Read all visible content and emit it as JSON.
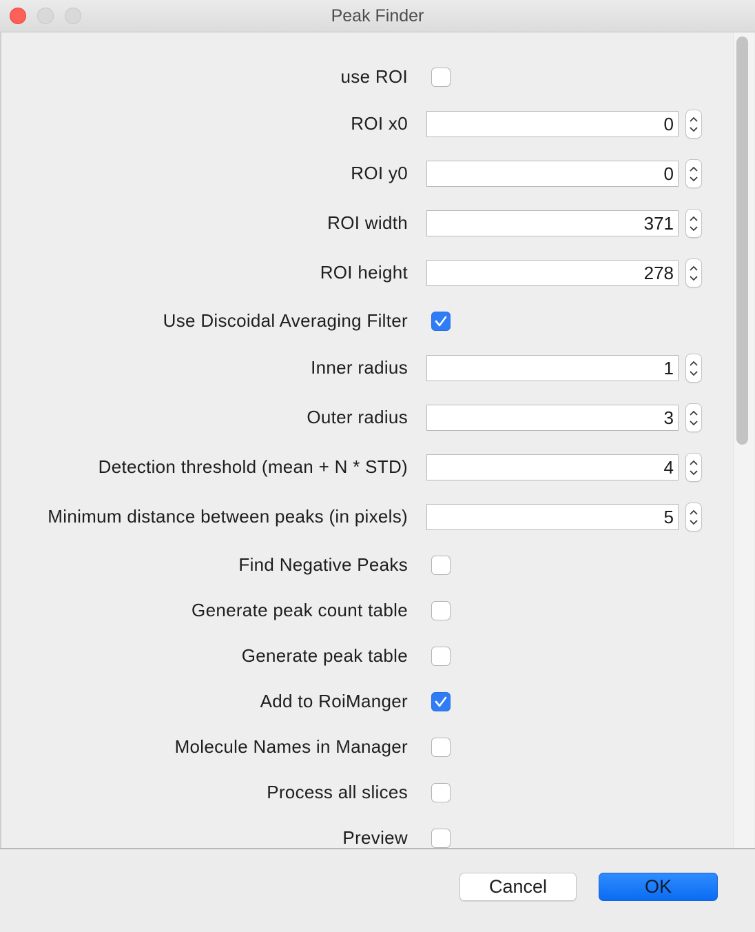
{
  "window": {
    "title": "Peak Finder"
  },
  "form": {
    "rows": [
      {
        "label": "use ROI",
        "type": "checkbox",
        "checked": false
      },
      {
        "label": "ROI x0",
        "type": "number",
        "value": "0"
      },
      {
        "label": "ROI y0",
        "type": "number",
        "value": "0"
      },
      {
        "label": "ROI width",
        "type": "number",
        "value": "371"
      },
      {
        "label": "ROI height",
        "type": "number",
        "value": "278"
      },
      {
        "label": "Use Discoidal Averaging Filter",
        "type": "checkbox",
        "checked": true
      },
      {
        "label": "Inner radius",
        "type": "number",
        "value": "1"
      },
      {
        "label": "Outer radius",
        "type": "number",
        "value": "3"
      },
      {
        "label": "Detection threshold (mean + N * STD)",
        "type": "number",
        "value": "4"
      },
      {
        "label": "Minimum distance between peaks (in pixels)",
        "type": "number",
        "value": "5"
      },
      {
        "label": "Find Negative Peaks",
        "type": "checkbox",
        "checked": false
      },
      {
        "label": "Generate peak count table",
        "type": "checkbox",
        "checked": false
      },
      {
        "label": "Generate peak table",
        "type": "checkbox",
        "checked": false
      },
      {
        "label": "Add to RoiManger",
        "type": "checkbox",
        "checked": true
      },
      {
        "label": "Molecule Names in Manager",
        "type": "checkbox",
        "checked": false
      },
      {
        "label": "Process all slices",
        "type": "checkbox",
        "checked": false
      },
      {
        "label": "Preview",
        "type": "checkbox",
        "checked": false
      }
    ]
  },
  "buttons": {
    "cancel_label": "Cancel",
    "ok_label": "OK"
  },
  "colors": {
    "accent": "#2e7cf6",
    "close_button": "#fe5f57",
    "window_bg": "#ececec"
  },
  "icons": {
    "checkmark": "checkmark-icon",
    "stepper": "chevron-up-down-icon"
  }
}
